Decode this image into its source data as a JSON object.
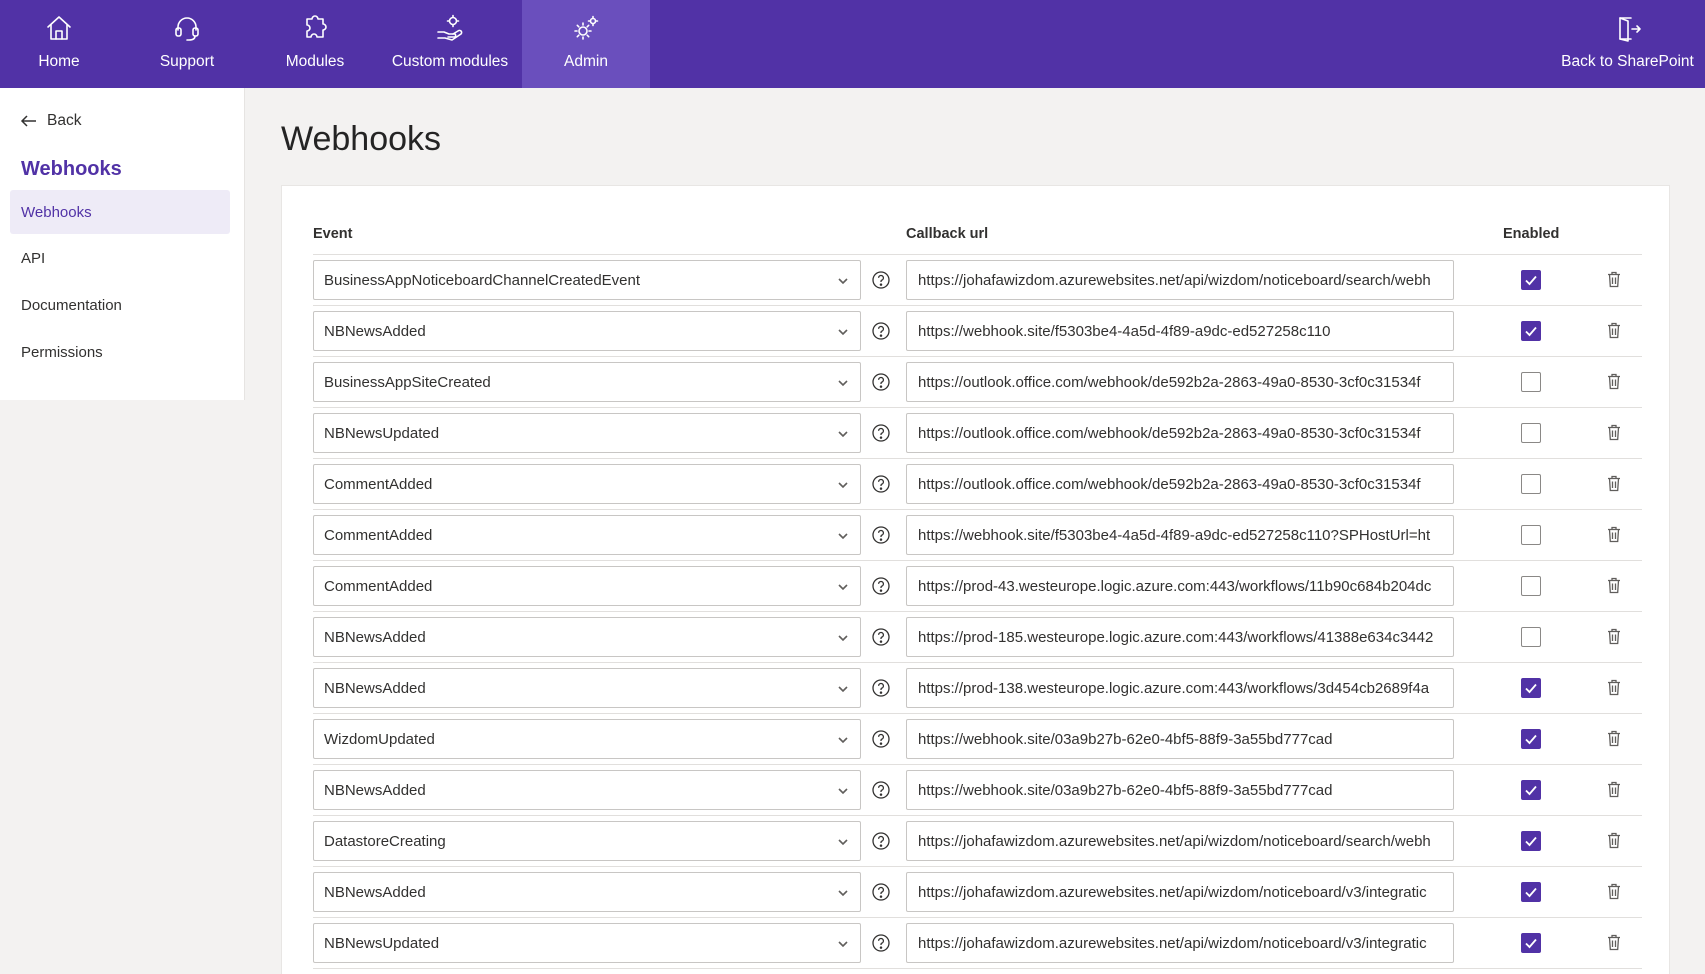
{
  "nav": {
    "items": [
      {
        "label": "Home",
        "icon": "home-icon"
      },
      {
        "label": "Support",
        "icon": "headset-icon"
      },
      {
        "label": "Modules",
        "icon": "puzzle-icon"
      },
      {
        "label": "Custom modules",
        "icon": "hand-gear-icon"
      },
      {
        "label": "Admin",
        "icon": "gears-icon",
        "active": true
      }
    ],
    "back_sharepoint": {
      "label": "Back to SharePoint",
      "icon": "exit-door-icon"
    }
  },
  "sidebar": {
    "back_label": "Back",
    "title": "Webhooks",
    "items": [
      {
        "label": "Webhooks",
        "active": true
      },
      {
        "label": "API"
      },
      {
        "label": "Documentation"
      },
      {
        "label": "Permissions"
      }
    ]
  },
  "main": {
    "title": "Webhooks",
    "columns": {
      "event": "Event",
      "callback": "Callback url",
      "enabled": "Enabled"
    },
    "rows": [
      {
        "event": "BusinessAppNoticeboardChannelCreatedEvent",
        "url": "https://johafawizdom.azurewebsites.net/api/wizdom/noticeboard/search/webh",
        "enabled": true
      },
      {
        "event": "NBNewsAdded",
        "url": "https://webhook.site/f5303be4-4a5d-4f89-a9dc-ed527258c110",
        "enabled": true
      },
      {
        "event": "BusinessAppSiteCreated",
        "url": "https://outlook.office.com/webhook/de592b2a-2863-49a0-8530-3cf0c31534f",
        "enabled": false
      },
      {
        "event": "NBNewsUpdated",
        "url": "https://outlook.office.com/webhook/de592b2a-2863-49a0-8530-3cf0c31534f",
        "enabled": false
      },
      {
        "event": "CommentAdded",
        "url": "https://outlook.office.com/webhook/de592b2a-2863-49a0-8530-3cf0c31534f",
        "enabled": false
      },
      {
        "event": "CommentAdded",
        "url": "https://webhook.site/f5303be4-4a5d-4f89-a9dc-ed527258c110?SPHostUrl=ht",
        "enabled": false
      },
      {
        "event": "CommentAdded",
        "url": "https://prod-43.westeurope.logic.azure.com:443/workflows/11b90c684b204dc",
        "enabled": false
      },
      {
        "event": "NBNewsAdded",
        "url": "https://prod-185.westeurope.logic.azure.com:443/workflows/41388e634c3442",
        "enabled": false
      },
      {
        "event": "NBNewsAdded",
        "url": "https://prod-138.westeurope.logic.azure.com:443/workflows/3d454cb2689f4a",
        "enabled": true
      },
      {
        "event": "WizdomUpdated",
        "url": "https://webhook.site/03a9b27b-62e0-4bf5-88f9-3a55bd777cad",
        "enabled": true
      },
      {
        "event": "NBNewsAdded",
        "url": "https://webhook.site/03a9b27b-62e0-4bf5-88f9-3a55bd777cad",
        "enabled": true
      },
      {
        "event": "DatastoreCreating",
        "url": "https://johafawizdom.azurewebsites.net/api/wizdom/noticeboard/search/webh",
        "enabled": true
      },
      {
        "event": "NBNewsAdded",
        "url": "https://johafawizdom.azurewebsites.net/api/wizdom/noticeboard/v3/integratic",
        "enabled": true
      },
      {
        "event": "NBNewsUpdated",
        "url": "https://johafawizdom.azurewebsites.net/api/wizdom/noticeboard/v3/integratic",
        "enabled": true
      }
    ]
  },
  "colors": {
    "brand": "#5132a6",
    "active_nav": "#6a4fbd",
    "sidebar_active_bg": "#eeebf7"
  }
}
